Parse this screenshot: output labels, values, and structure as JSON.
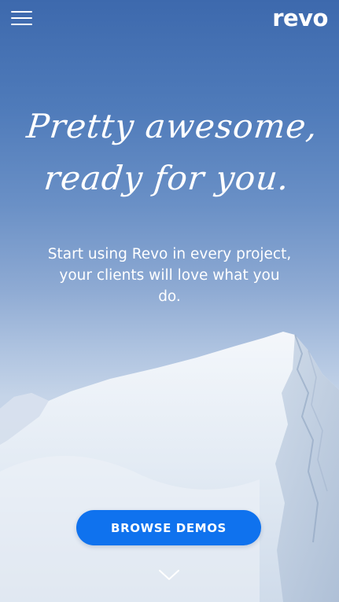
{
  "header": {
    "brand": "revo",
    "menu_icon": "hamburger-menu-icon"
  },
  "hero": {
    "headline_line1": "Pretty awesome,",
    "headline_line2": "ready for you.",
    "subtitle": "Start using Revo in every project, your clients will love what you do.",
    "cta_label": "BROWSE DEMOS",
    "scroll_icon": "chevron-down-icon"
  },
  "colors": {
    "sky_top": "#3d69ad",
    "sky_bottom": "#d6e0ee",
    "button": "#0f72ee",
    "text": "#ffffff"
  }
}
